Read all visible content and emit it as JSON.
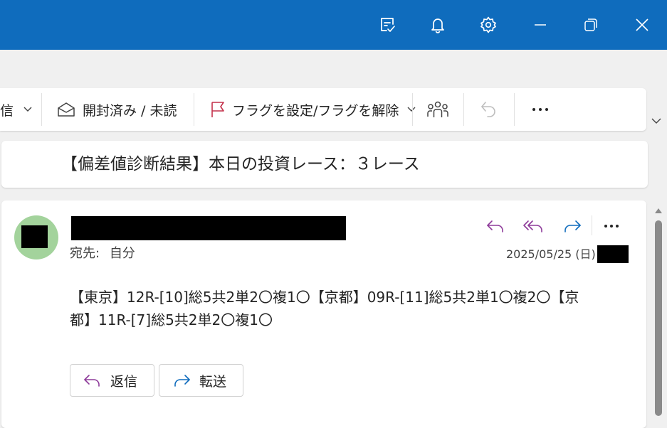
{
  "window": {
    "icons": [
      "tasks-icon",
      "bell-icon",
      "gear-icon",
      "minimize-icon",
      "restore-icon",
      "close-icon"
    ]
  },
  "ribbon": {
    "reply_partial": "信",
    "mark_read_label": "開封済み / 未読",
    "flag_label": "フラグを設定/フラグを解除"
  },
  "message": {
    "subject": "【偏差値診断結果】本日の投資レース：３レース",
    "to_label": "宛先:",
    "to_value": "自分",
    "date": "2025/05/25 (日)",
    "body_line1": "【東京】12R-[10]総5共2単2〇複1〇【京都】09R-[11]総5共2単1〇複2〇【京",
    "body_line2": "都】11R-[7]総5共2単2〇複1〇",
    "reply_button": "返信",
    "forward_button": "転送"
  },
  "colors": {
    "titlebar": "#0f6cbd",
    "avatar": "#a3d39c",
    "reply_purple": "#8e3b9a",
    "forward_blue": "#0f6cbd",
    "flag_red": "#c4314b"
  }
}
